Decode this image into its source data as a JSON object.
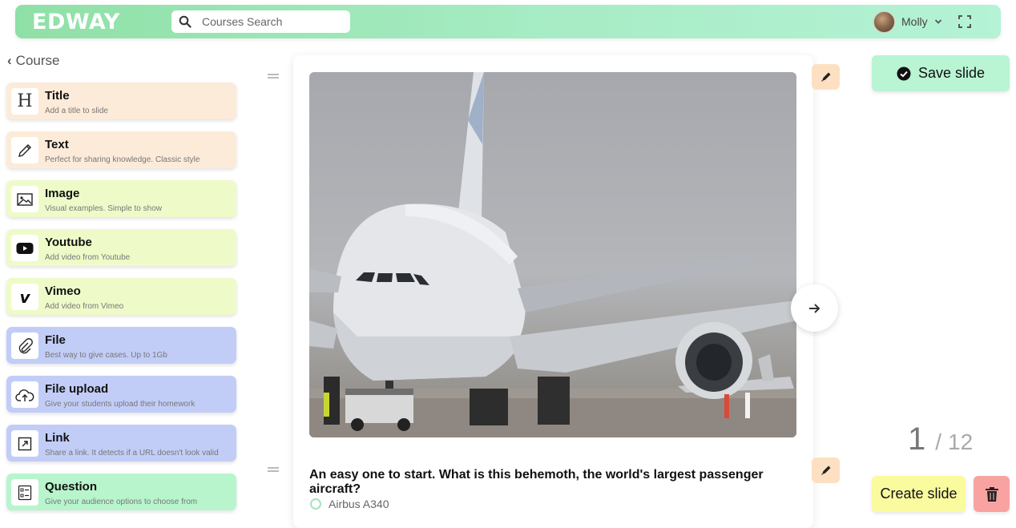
{
  "header": {
    "logo": "EDWAY",
    "search_placeholder": "Courses Search",
    "user_name": "Molly"
  },
  "sidebar": {
    "back_label": "Course",
    "blocks": [
      {
        "title": "Title",
        "desc": "Add a title to slide",
        "icon": "heading-icon",
        "color": "#fdebd9"
      },
      {
        "title": "Text",
        "desc": "Perfect for sharing knowledge. Classic style",
        "icon": "pencil-icon",
        "color": "#fdebd9"
      },
      {
        "title": "Image",
        "desc": "Visual examples. Simple to show",
        "icon": "image-icon",
        "color": "#eefbc9"
      },
      {
        "title": "Youtube",
        "desc": "Add video from Youtube",
        "icon": "youtube-icon",
        "color": "#eefbc9"
      },
      {
        "title": "Vimeo",
        "desc": "Add video from Vimeo",
        "icon": "vimeo-icon",
        "color": "#eefbc9"
      },
      {
        "title": "File",
        "desc": "Best way to give cases. Up to 1Gb",
        "icon": "paperclip-icon",
        "color": "#c2cdf7"
      },
      {
        "title": "File upload",
        "desc": "Give your students upload their homework",
        "icon": "cloud-upload-icon",
        "color": "#c2cdf7"
      },
      {
        "title": "Link",
        "desc": "Share a link. It detects if a URL doesn't look valid",
        "icon": "external-link-icon",
        "color": "#c2cdf7"
      },
      {
        "title": "Question",
        "desc": "Give your audience options to choose from",
        "icon": "checklist-icon",
        "color": "#b8f5cd"
      }
    ]
  },
  "slide": {
    "question": "An easy one to start. What is this behemoth, the world's largest passenger aircraft?",
    "options": [
      "Airbus A340"
    ]
  },
  "actions": {
    "save_label": "Save slide",
    "create_label": "Create slide",
    "current": "1",
    "separator": "/",
    "total": "12"
  }
}
